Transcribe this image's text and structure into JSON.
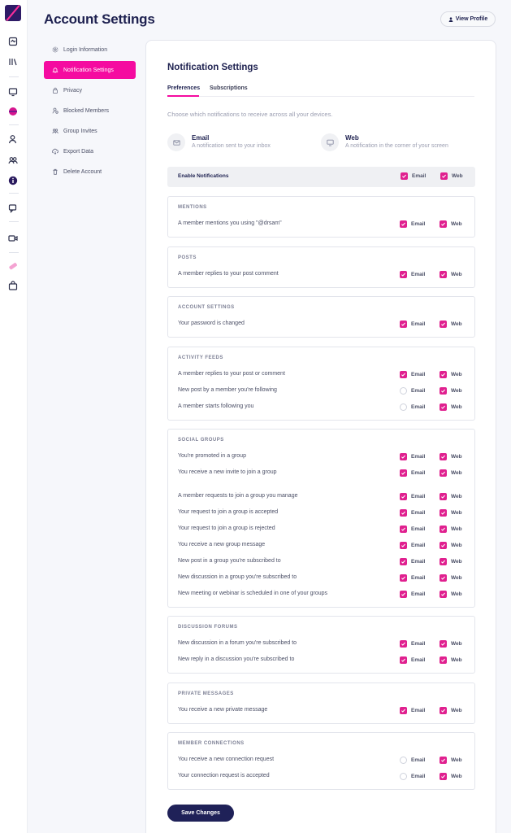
{
  "header": {
    "title": "Account Settings",
    "view_profile_label": "View Profile"
  },
  "menu": [
    {
      "label": "Login Information",
      "icon": "gear-icon",
      "active": false
    },
    {
      "label": "Notification Settings",
      "icon": "bell-icon",
      "active": true
    },
    {
      "label": "Privacy",
      "icon": "lock-icon",
      "active": false
    },
    {
      "label": "Blocked Members",
      "icon": "user-block-icon",
      "active": false
    },
    {
      "label": "Group Invites",
      "icon": "group-icon",
      "active": false
    },
    {
      "label": "Export Data",
      "icon": "cloud-download-icon",
      "active": false
    },
    {
      "label": "Delete Account",
      "icon": "trash-icon",
      "active": false
    }
  ],
  "main": {
    "title": "Notification Settings",
    "tabs": [
      {
        "label": "Preferences",
        "active": true
      },
      {
        "label": "Subscriptions",
        "active": false
      }
    ],
    "intro": "Choose which notifications to receive across all your devices.",
    "channels": {
      "email": {
        "title": "Email",
        "desc": "A notification sent to your inbox"
      },
      "web": {
        "title": "Web",
        "desc": "A notification in the corner of your screen"
      }
    },
    "enable": {
      "label": "Enable Notifications",
      "email_label": "Email",
      "web_label": "Web",
      "email": true,
      "web": true
    },
    "email_label": "Email",
    "web_label": "Web",
    "sections": [
      {
        "title": "MENTIONS",
        "rows": [
          {
            "label": "A member mentions you using \"@drsam\"",
            "email": true,
            "web": true
          }
        ]
      },
      {
        "title": "POSTS",
        "rows": [
          {
            "label": "A member replies to your post comment",
            "email": true,
            "web": true
          }
        ]
      },
      {
        "title": "ACCOUNT SETTINGS",
        "rows": [
          {
            "label": "Your password is changed",
            "email": true,
            "web": true
          }
        ]
      },
      {
        "title": "ACTIVITY FEEDS",
        "rows": [
          {
            "label": "A member replies to your post or comment",
            "email": true,
            "web": true
          },
          {
            "label": "New post by a member you're following",
            "email": false,
            "web": true
          },
          {
            "label": "A member starts following you",
            "email": false,
            "web": true
          }
        ]
      },
      {
        "title": "SOCIAL GROUPS",
        "rows": [
          {
            "label": "You're promoted in a group",
            "email": true,
            "web": true
          },
          {
            "label": "You receive a new invite to join a group",
            "email": true,
            "web": true
          },
          {
            "label": "A member requests to join a group you manage",
            "email": true,
            "web": true
          },
          {
            "label": "Your request to join a group is accepted",
            "email": true,
            "web": true
          },
          {
            "label": "Your request to join a group is rejected",
            "email": true,
            "web": true
          },
          {
            "label": "You receive a new group message",
            "email": true,
            "web": true
          },
          {
            "label": "New post in a group you're subscribed to",
            "email": true,
            "web": true
          },
          {
            "label": "New discussion in a group you're subscribed to",
            "email": true,
            "web": true
          },
          {
            "label": "New meeting or webinar is scheduled in one of your groups",
            "email": true,
            "web": true
          }
        ]
      },
      {
        "title": "DISCUSSION FORUMS",
        "rows": [
          {
            "label": "New discussion in a forum you're subscribed to",
            "email": true,
            "web": true
          },
          {
            "label": "New reply in a discussion you're subscribed to",
            "email": true,
            "web": true
          }
        ]
      },
      {
        "title": "PRIVATE MESSAGES",
        "rows": [
          {
            "label": "You receive a new private message",
            "email": true,
            "web": true
          }
        ]
      },
      {
        "title": "MEMBER CONNECTIONS",
        "rows": [
          {
            "label": "You receive a new connection request",
            "email": false,
            "web": true
          },
          {
            "label": "Your connection request is accepted",
            "email": false,
            "web": true
          }
        ]
      }
    ],
    "save_label": "Save Changes"
  },
  "colors": {
    "accent": "#f50ba0",
    "checkbox": "#e0208f",
    "navy": "#1e2150"
  }
}
